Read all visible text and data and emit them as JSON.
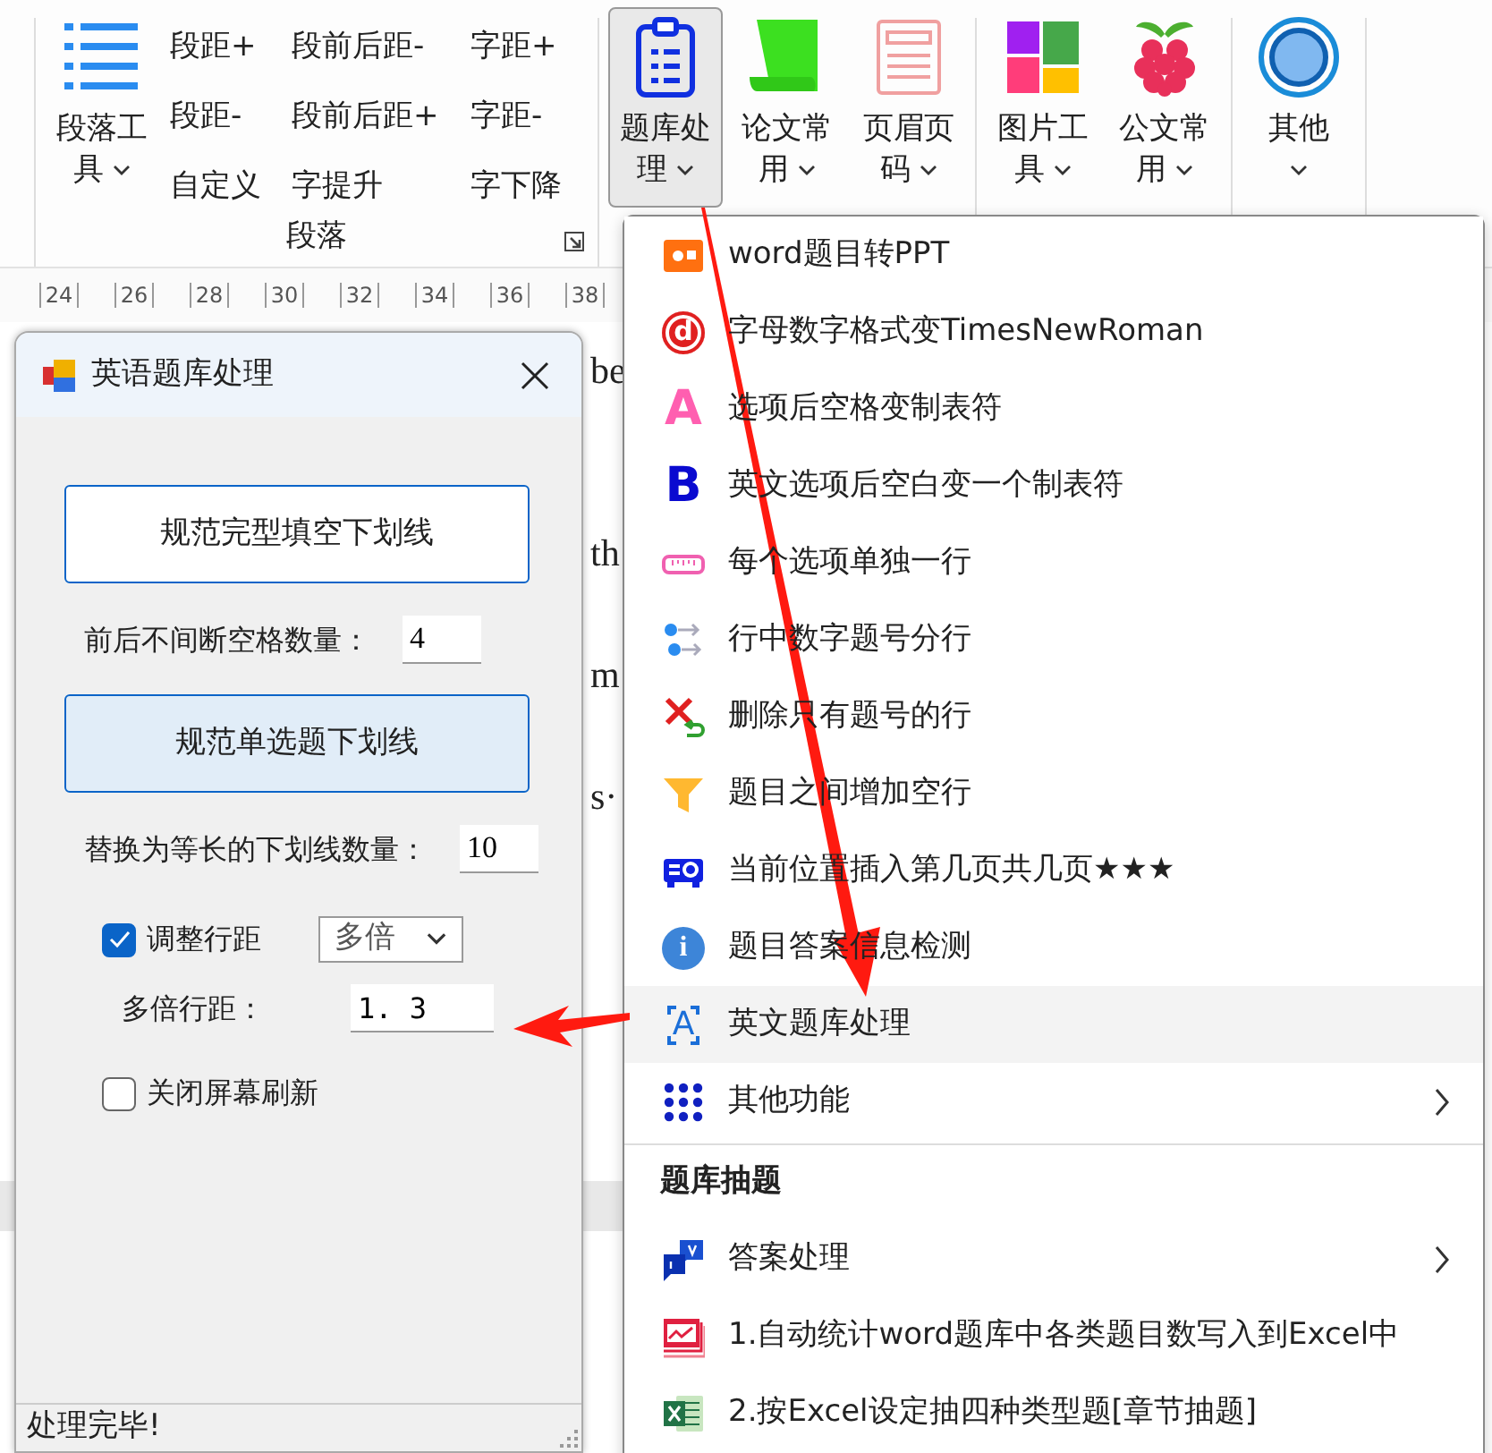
{
  "ribbon": {
    "groups": [
      {
        "label": "段落",
        "launcher": true,
        "large_buttons": [
          {
            "label": "段落工具",
            "dropdown": true,
            "pressed": false
          }
        ],
        "small_buttons": [
          "段距+",
          "段前后距-",
          "字距+",
          "段距-",
          "段前后距+",
          "字距-",
          "自定义",
          "字提升",
          "字下降"
        ]
      },
      {
        "large_buttons": [
          {
            "label": "题库处理",
            "dropdown": true,
            "pressed": true
          },
          {
            "label": "论文常用",
            "dropdown": true,
            "pressed": false
          },
          {
            "label": "页眉页码",
            "dropdown": true,
            "pressed": false
          }
        ]
      },
      {
        "large_buttons": [
          {
            "label": "图片工具",
            "dropdown": true,
            "pressed": false
          },
          {
            "label": "公文常用",
            "dropdown": true,
            "pressed": false
          }
        ]
      },
      {
        "large_buttons": [
          {
            "label": "其他",
            "dropdown": true,
            "caret_below": true,
            "pressed": false
          }
        ]
      }
    ]
  },
  "ruler": {
    "ticks": [
      "24",
      "26",
      "28",
      "30",
      "32",
      "34",
      "36",
      "38"
    ]
  },
  "document": {
    "lines": [
      {
        "kind": "text",
        "right": "be"
      },
      {
        "kind": "blank"
      },
      {
        "kind": "blank"
      },
      {
        "kind": "text",
        "right": "th"
      },
      {
        "kind": "blank"
      },
      {
        "kind": "text",
        "right": "m"
      },
      {
        "kind": "blank"
      },
      {
        "kind": "text",
        "right": "s·"
      }
    ]
  },
  "dialog": {
    "title": "英语题库处理",
    "controls": [
      {
        "kind": "button",
        "label": "规范完型填空下划线",
        "highlighted": false
      },
      {
        "kind": "number",
        "label": "前后不间断空格数量：",
        "value": "4"
      },
      {
        "kind": "button",
        "label": "规范单选题下划线",
        "highlighted": true
      },
      {
        "kind": "number",
        "label": "替换为等长的下划线数量：",
        "value": "10"
      },
      {
        "kind": "checkbox_select",
        "label": "调整行距",
        "checked": true,
        "value": "多倍"
      },
      {
        "kind": "number_indented",
        "label": "多倍行距：",
        "value": "1. 3"
      },
      {
        "kind": "checkbox",
        "label": "关闭屏幕刷新",
        "checked": false
      }
    ],
    "status": "处理完毕!"
  },
  "menu": {
    "items": [
      {
        "kind": "item",
        "label": "word题目转PPT",
        "selected": false
      },
      {
        "kind": "item",
        "label": "字母数字格式变TimesNewRoman",
        "icon_glyph": "d",
        "selected": false
      },
      {
        "kind": "item",
        "label": "选项后空格变制表符",
        "icon_glyph": "A",
        "selected": false
      },
      {
        "kind": "item",
        "label": "英文选项后空白变一个制表符",
        "icon_glyph": "B",
        "selected": false
      },
      {
        "kind": "item",
        "label": "每个选项单独一行",
        "selected": false
      },
      {
        "kind": "item",
        "label": "行中数字题号分行",
        "selected": false
      },
      {
        "kind": "item",
        "label": "删除只有题号的行",
        "selected": false
      },
      {
        "kind": "item",
        "label": "题目之间增加空行",
        "selected": false
      },
      {
        "kind": "item",
        "label": "当前位置插入第几页共几页★★★",
        "selected": false
      },
      {
        "kind": "item",
        "label": "题目答案信息检测",
        "icon_glyph": "i",
        "selected": false
      },
      {
        "kind": "item",
        "label": "英文题库处理",
        "icon_glyph": "A",
        "selected": true
      },
      {
        "kind": "item",
        "label": "其他功能",
        "submenu": true,
        "selected": false
      },
      {
        "kind": "header",
        "label": "题库抽题"
      },
      {
        "kind": "item",
        "label": "答案处理",
        "submenu": true,
        "selected": false
      },
      {
        "kind": "item",
        "label": "1.自动统计word题库中各类题目数写入到Excel中",
        "selected": false
      },
      {
        "kind": "item",
        "label": "2.按Excel设定抽四种类型题[章节抽题]",
        "selected": false
      }
    ]
  }
}
